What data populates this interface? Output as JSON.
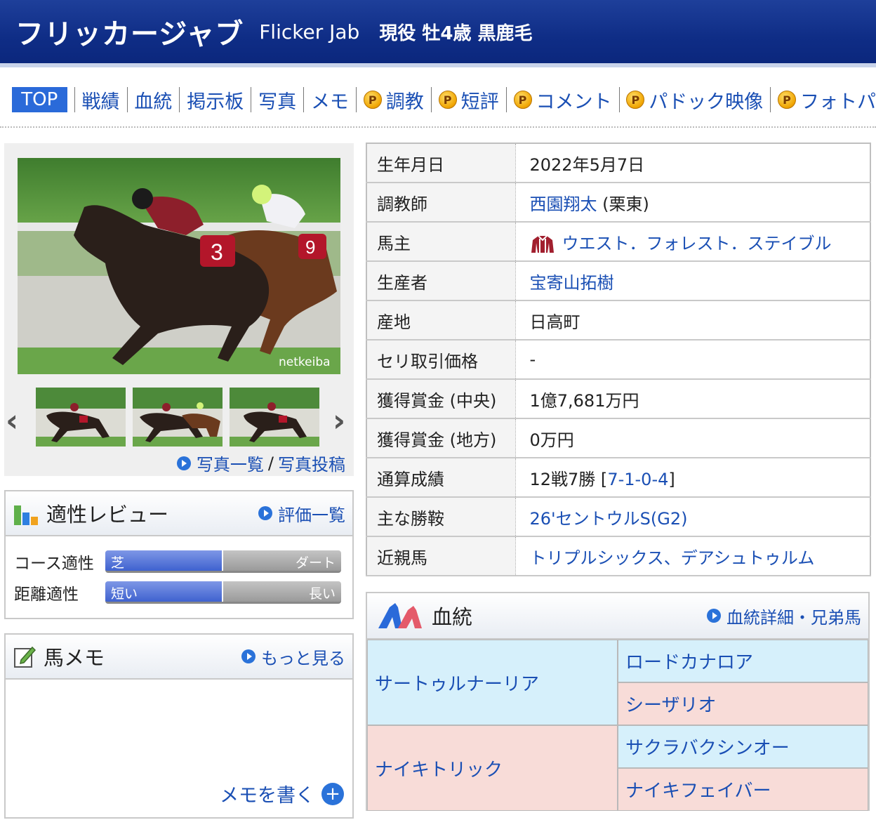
{
  "header": {
    "name_ja": "フリッカージャブ",
    "name_en": "Flicker Jab",
    "meta": "現役 牡4歳 黒鹿毛"
  },
  "nav": {
    "top": "TOP",
    "items": [
      "戦績",
      "血統",
      "掲示板",
      "写真",
      "メモ"
    ],
    "premium_items": [
      "調教",
      "短評",
      "コメント",
      "パドック映像",
      "フォトパ"
    ],
    "premium_icon": "P"
  },
  "photo": {
    "watermark": "netkeiba",
    "prev_icon": "chevron-left-icon",
    "next_icon": "chevron-right-icon",
    "link_list": "写真一覧",
    "link_sep": "/",
    "link_post": "写真投稿"
  },
  "aptitude": {
    "title": "適性レビュー",
    "more": "評価一覧",
    "rows": [
      {
        "label": "コース適性",
        "left": "芝",
        "right": "ダート",
        "level": 0.5
      },
      {
        "label": "距離適性",
        "left": "短い",
        "right": "長い",
        "level": 0.5
      }
    ]
  },
  "memo": {
    "title": "馬メモ",
    "more": "もっと見る",
    "write": "メモを書く"
  },
  "profile": {
    "rows": [
      {
        "key": "生年月日",
        "value": "2022年5月7日"
      },
      {
        "key": "調教師",
        "link": "西園翔太",
        "suffix": " (栗東)"
      },
      {
        "key": "馬主",
        "link": "ウエスト．フォレスト．ステイブル"
      },
      {
        "key": "生産者",
        "link": "宝寄山拓樹"
      },
      {
        "key": "産地",
        "value": "日高町"
      },
      {
        "key": "セリ取引価格",
        "value": "-"
      },
      {
        "key": "獲得賞金 (中央)",
        "value": "1億7,681万円"
      },
      {
        "key": "獲得賞金 (地方)",
        "value": "0万円"
      },
      {
        "key": "通算成績",
        "value": "12戦7勝 [",
        "link": "7-1-0-4",
        "suffix": "]"
      },
      {
        "key": "主な勝鞍",
        "link": "26'セントウルS(G2)"
      },
      {
        "key": "近親馬",
        "link": "トリプルシックス、デアシュトゥルム"
      }
    ]
  },
  "pedigree": {
    "title": "血統",
    "more": "血統詳細・兄弟馬",
    "sire": "サートゥルナーリア",
    "sire_sire": "ロードカナロア",
    "sire_dam": "シーザリオ",
    "dam": "ナイキトリック",
    "dam_sire": "サクラバクシンオー",
    "dam_dam": "ナイキフェイバー"
  },
  "colors": {
    "header_bg": "#0f2d86",
    "link": "#1a4fb4",
    "male_cell": "#d6f0fb",
    "female_cell": "#f8dcd8"
  }
}
